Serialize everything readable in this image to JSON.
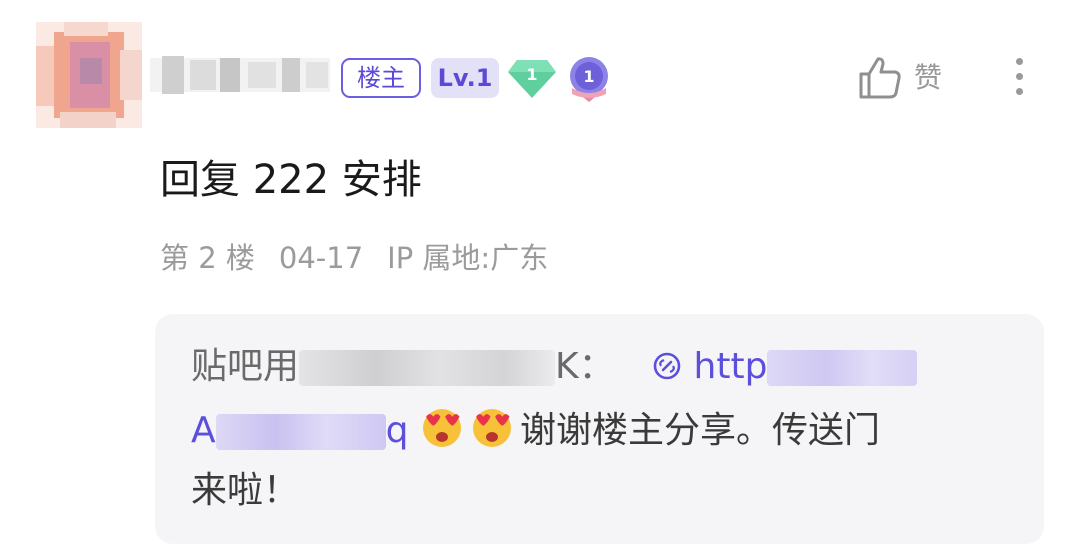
{
  "post": {
    "badges": {
      "louzhu": "楼主",
      "level": "Lv.1",
      "gem_number": "1",
      "medal_number": "1"
    },
    "like_label": "赞",
    "reply_text": "回复 222 安排",
    "meta": {
      "floor": "第 2 楼",
      "date": "04-17",
      "ip_location": "IP 属地:广东"
    },
    "quote": {
      "author_prefix": "贴吧用",
      "author_suffix": "K：",
      "link_start": "http",
      "link_line2_start": "A",
      "link_line2_end": "q",
      "message": "谢谢楼主分享。传送门",
      "message_line3": "来啦！"
    }
  },
  "colors": {
    "accent": "#5a4ad6",
    "link": "#5b4fdc",
    "meta_gray": "#9b9b9b",
    "quote_bg": "#f5f5f7"
  },
  "icons": [
    "gem-icon",
    "medal-icon",
    "thumb-up-icon",
    "more-vertical-icon",
    "link-icon",
    "heart-eyes-emoji-icon"
  ]
}
